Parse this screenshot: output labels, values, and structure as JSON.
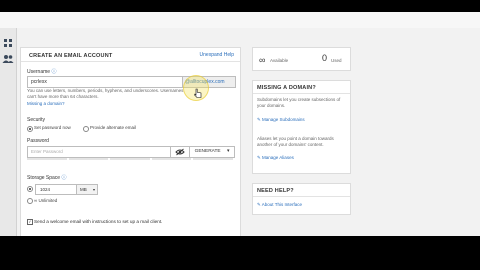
{
  "create_account": {
    "title": "CREATE AN EMAIL ACCOUNT",
    "expand_help": "Unexpand Help",
    "username": {
      "label": "Username",
      "value": "pcrlesx",
      "domain": "@alltocuplex.com",
      "help": "You can use letters, numbers, periods, hyphens, and underscores. Usernames can't have more than 64 characters.",
      "missing_domain": "Missing a domain?"
    },
    "security": {
      "label": "Security",
      "option_set": "Set password now",
      "option_alternate": "Provide alternate email"
    },
    "password": {
      "label": "Password",
      "placeholder": "Enter Password",
      "generate": "GENERATE",
      "strength_segments": 5,
      "strength_filled": 0
    },
    "storage": {
      "label": "Storage Space",
      "value": "1024",
      "unit": "MB",
      "unlimited": "Unlimited"
    },
    "welcome": "Send a welcome email with instructions to set up a mail client."
  },
  "stats": {
    "available_label": "Available",
    "used_value": "0",
    "used_label": "Used"
  },
  "missing_domain_panel": {
    "title": "MISSING A DOMAIN?",
    "text1": "Subdomains let you create subsections of your domains.",
    "link1": "Manage Subdomains",
    "text2": "Aliases let you point a domain towards another of your domains' content.",
    "link2": "Manage Aliases"
  },
  "need_help_panel": {
    "title": "NEED HELP?",
    "link": "About This Interface"
  },
  "colors": {
    "link": "#2a6ebb",
    "highlight": "#f4e15a"
  },
  "icons": {
    "sidebar": [
      "grid-icon",
      "users-icon"
    ],
    "infinity": "infinity-icon",
    "eye": "eye-slash-icon",
    "caret": "caret-down-icon",
    "wrench": "wrench-icon",
    "edit": "edit-icon"
  }
}
